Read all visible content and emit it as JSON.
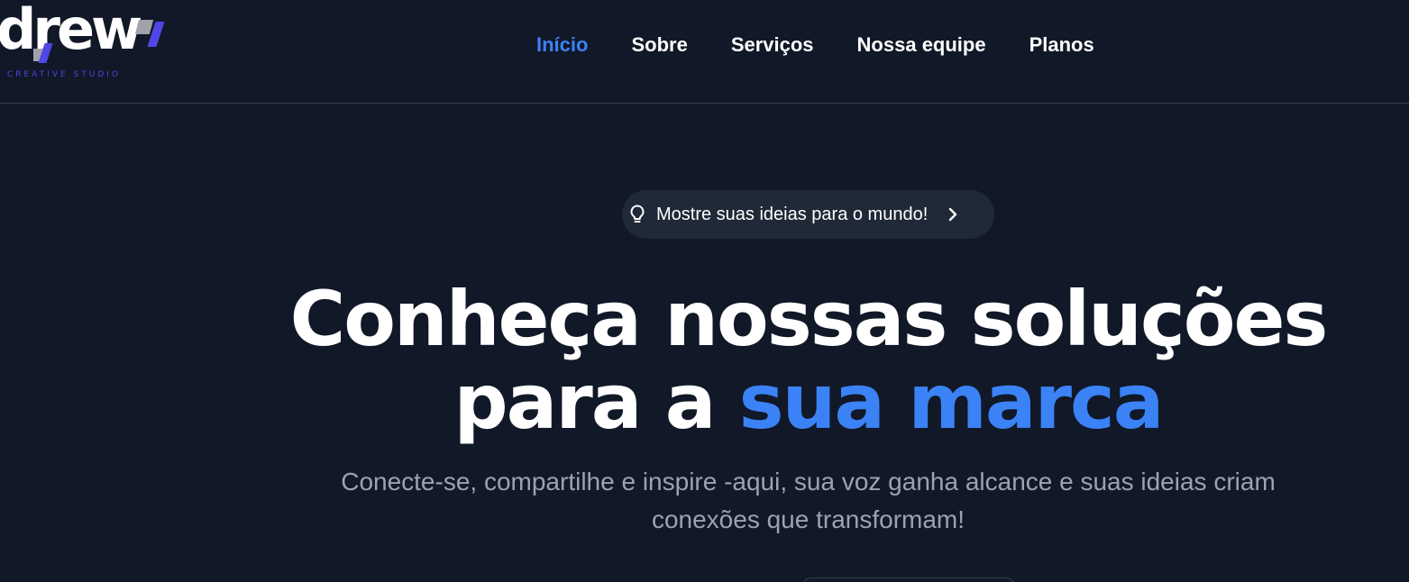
{
  "brand": {
    "name": "drew",
    "tagline": "CREATIVE STUDIO",
    "accent_color": "#3b82f6",
    "logo_color": "#4f46e5"
  },
  "nav": {
    "items": [
      {
        "label": "Início",
        "active": true
      },
      {
        "label": "Sobre",
        "active": false
      },
      {
        "label": "Serviços",
        "active": false
      },
      {
        "label": "Nossa equipe",
        "active": false
      },
      {
        "label": "Planos",
        "active": false
      }
    ]
  },
  "hero": {
    "pill": {
      "icon": "lightbulb-icon",
      "text": "Mostre suas ideias para o mundo!",
      "chevron_icon": "chevron-right-icon"
    },
    "title_line1": "Conheça nossas soluções",
    "title_line2_prefix": "para a ",
    "title_line2_accent": "sua marca",
    "subtitle": "Conecte-se, compartilhe e inspire -aqui, sua voz ganha alcance e suas ideias criam conexões que transformam!"
  },
  "colors": {
    "background": "#111827",
    "pill_bg": "#1f2937",
    "subtitle": "#9ca3af",
    "divider": "#374151"
  }
}
